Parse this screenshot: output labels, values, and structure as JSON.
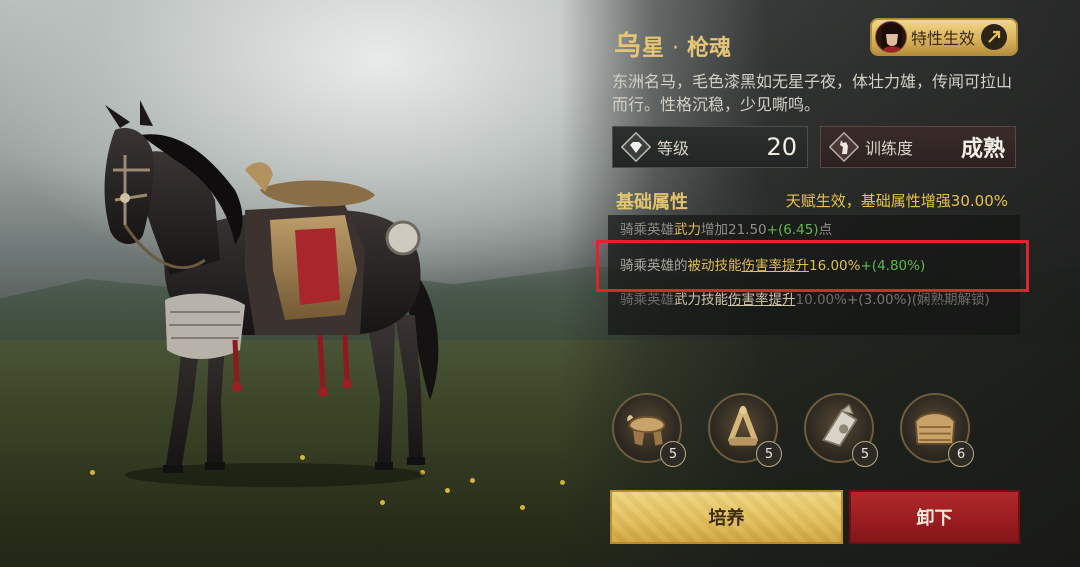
{
  "horse": {
    "name": "乌",
    "name_rest": "星",
    "separator": "·",
    "title": "枪魂",
    "description": "东洲名马，毛色漆黑如无星子夜，体壮力雄，传闻可拉山而行。性格沉稳，少见嘶鸣。"
  },
  "trait_badge": {
    "label": "特性生效"
  },
  "stats": {
    "level_label": "等级",
    "level_value": "20",
    "training_label": "训练度",
    "training_value": "成熟"
  },
  "attributes": {
    "heading": "基础属性",
    "bonus_note": "天赋生效，基础属性增强30.00%",
    "rows": [
      {
        "prefix": "骑乘英雄",
        "key": "武力",
        "middle": "增加",
        "value": "21.50",
        "bonus": "+(6.45)",
        "suffix": "点"
      },
      {
        "prefix": "骑乘英雄的",
        "key": "被动技能",
        "key2": "伤害率提升",
        "value": "16.00%",
        "bonus": "+(4.80%)"
      },
      {
        "prefix": "骑乘英雄",
        "key": "武力技能",
        "key2": "伤害率提升",
        "value": "10.00%",
        "bonus": "+(3.00%)",
        "suffix": "(娴熟期解锁)"
      }
    ]
  },
  "equipment": [
    {
      "icon": "saddle-icon",
      "level": "5"
    },
    {
      "icon": "stirrup-icon",
      "level": "5"
    },
    {
      "icon": "horse-armor-head-icon",
      "level": "5"
    },
    {
      "icon": "barding-icon",
      "level": "6"
    }
  ],
  "buttons": {
    "train": "培养",
    "unequip": "卸下"
  },
  "colors": {
    "gold": "#e6c576",
    "green": "#5fb94a",
    "red_button": "#a8232a",
    "gold_button": "#e2bd58",
    "highlight_frame": "#e0242c"
  }
}
